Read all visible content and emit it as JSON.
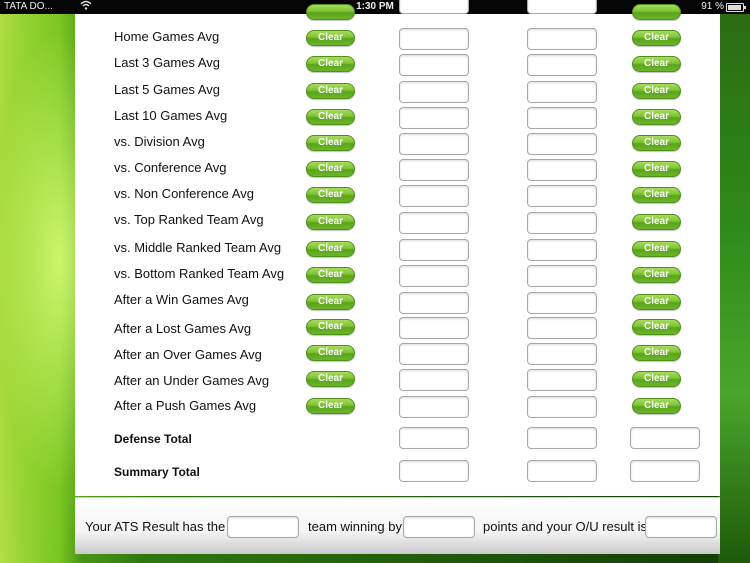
{
  "status_bar": {
    "carrier": "TATA DO...",
    "time": "1:30 PM",
    "battery": "91 %"
  },
  "clear_label": "Clear",
  "rows": [
    {
      "label": "Home Games Avg"
    },
    {
      "label": "Last 3 Games Avg"
    },
    {
      "label": "Last 5 Games Avg"
    },
    {
      "label": "Last 10 Games Avg"
    },
    {
      "label": "vs. Division Avg"
    },
    {
      "label": "vs. Conference Avg"
    },
    {
      "label": "vs. Non Conference Avg"
    },
    {
      "label": "vs. Top Ranked Team Avg"
    },
    {
      "label": "vs. Middle Ranked Team Avg"
    },
    {
      "label": "vs. Bottom Ranked Team Avg"
    },
    {
      "label": "After a Win Games Avg"
    },
    {
      "label": "After a Lost Games Avg"
    },
    {
      "label": "After an Over Games Avg"
    },
    {
      "label": "After an Under Games Avg"
    },
    {
      "label": "After a Push Games Avg"
    }
  ],
  "totals": [
    {
      "label": "Defense Total"
    },
    {
      "label": "Summary Total"
    }
  ],
  "result": {
    "prefix": "Your ATS Result has the",
    "middle": "team winning by",
    "suffix": "points and your O/U result is"
  }
}
